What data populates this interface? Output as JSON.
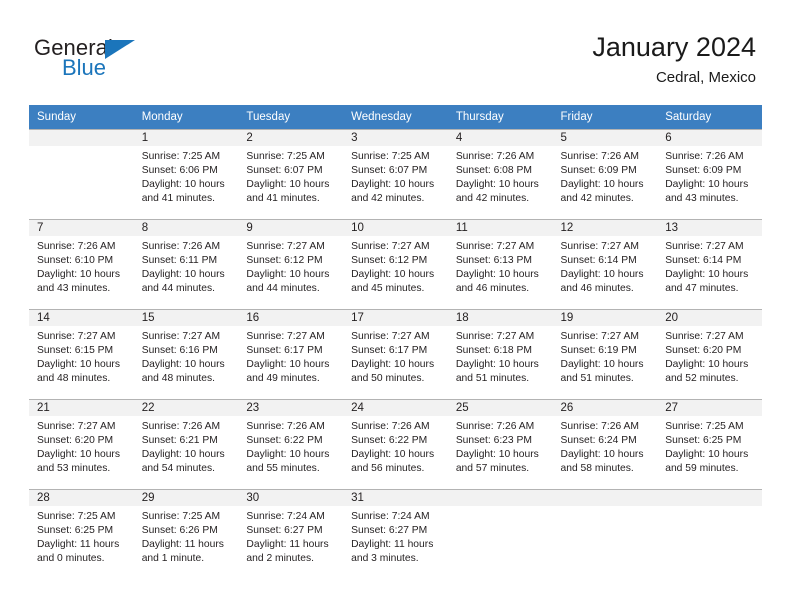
{
  "logo": {
    "word1": "General",
    "word2": "Blue",
    "triangle_color": "#1b75bb",
    "text_color": "#231f20"
  },
  "header": {
    "title": "January 2024",
    "subtitle": "Cedral, Mexico"
  },
  "theme": {
    "header_row_bg": "#3c7fc1",
    "header_row_text": "#ffffff",
    "daynum_bg": "#f2f2f2",
    "grid_line": "#b3b3b3",
    "body_text": "#231f20"
  },
  "weekdays": [
    "Sunday",
    "Monday",
    "Tuesday",
    "Wednesday",
    "Thursday",
    "Friday",
    "Saturday"
  ],
  "weeks": [
    [
      {
        "day": ""
      },
      {
        "day": "1",
        "sunrise": "Sunrise: 7:25 AM",
        "sunset": "Sunset: 6:06 PM",
        "daylight": "Daylight: 10 hours and 41 minutes."
      },
      {
        "day": "2",
        "sunrise": "Sunrise: 7:25 AM",
        "sunset": "Sunset: 6:07 PM",
        "daylight": "Daylight: 10 hours and 41 minutes."
      },
      {
        "day": "3",
        "sunrise": "Sunrise: 7:25 AM",
        "sunset": "Sunset: 6:07 PM",
        "daylight": "Daylight: 10 hours and 42 minutes."
      },
      {
        "day": "4",
        "sunrise": "Sunrise: 7:26 AM",
        "sunset": "Sunset: 6:08 PM",
        "daylight": "Daylight: 10 hours and 42 minutes."
      },
      {
        "day": "5",
        "sunrise": "Sunrise: 7:26 AM",
        "sunset": "Sunset: 6:09 PM",
        "daylight": "Daylight: 10 hours and 42 minutes."
      },
      {
        "day": "6",
        "sunrise": "Sunrise: 7:26 AM",
        "sunset": "Sunset: 6:09 PM",
        "daylight": "Daylight: 10 hours and 43 minutes."
      }
    ],
    [
      {
        "day": "7",
        "sunrise": "Sunrise: 7:26 AM",
        "sunset": "Sunset: 6:10 PM",
        "daylight": "Daylight: 10 hours and 43 minutes."
      },
      {
        "day": "8",
        "sunrise": "Sunrise: 7:26 AM",
        "sunset": "Sunset: 6:11 PM",
        "daylight": "Daylight: 10 hours and 44 minutes."
      },
      {
        "day": "9",
        "sunrise": "Sunrise: 7:27 AM",
        "sunset": "Sunset: 6:12 PM",
        "daylight": "Daylight: 10 hours and 44 minutes."
      },
      {
        "day": "10",
        "sunrise": "Sunrise: 7:27 AM",
        "sunset": "Sunset: 6:12 PM",
        "daylight": "Daylight: 10 hours and 45 minutes."
      },
      {
        "day": "11",
        "sunrise": "Sunrise: 7:27 AM",
        "sunset": "Sunset: 6:13 PM",
        "daylight": "Daylight: 10 hours and 46 minutes."
      },
      {
        "day": "12",
        "sunrise": "Sunrise: 7:27 AM",
        "sunset": "Sunset: 6:14 PM",
        "daylight": "Daylight: 10 hours and 46 minutes."
      },
      {
        "day": "13",
        "sunrise": "Sunrise: 7:27 AM",
        "sunset": "Sunset: 6:14 PM",
        "daylight": "Daylight: 10 hours and 47 minutes."
      }
    ],
    [
      {
        "day": "14",
        "sunrise": "Sunrise: 7:27 AM",
        "sunset": "Sunset: 6:15 PM",
        "daylight": "Daylight: 10 hours and 48 minutes."
      },
      {
        "day": "15",
        "sunrise": "Sunrise: 7:27 AM",
        "sunset": "Sunset: 6:16 PM",
        "daylight": "Daylight: 10 hours and 48 minutes."
      },
      {
        "day": "16",
        "sunrise": "Sunrise: 7:27 AM",
        "sunset": "Sunset: 6:17 PM",
        "daylight": "Daylight: 10 hours and 49 minutes."
      },
      {
        "day": "17",
        "sunrise": "Sunrise: 7:27 AM",
        "sunset": "Sunset: 6:17 PM",
        "daylight": "Daylight: 10 hours and 50 minutes."
      },
      {
        "day": "18",
        "sunrise": "Sunrise: 7:27 AM",
        "sunset": "Sunset: 6:18 PM",
        "daylight": "Daylight: 10 hours and 51 minutes."
      },
      {
        "day": "19",
        "sunrise": "Sunrise: 7:27 AM",
        "sunset": "Sunset: 6:19 PM",
        "daylight": "Daylight: 10 hours and 51 minutes."
      },
      {
        "day": "20",
        "sunrise": "Sunrise: 7:27 AM",
        "sunset": "Sunset: 6:20 PM",
        "daylight": "Daylight: 10 hours and 52 minutes."
      }
    ],
    [
      {
        "day": "21",
        "sunrise": "Sunrise: 7:27 AM",
        "sunset": "Sunset: 6:20 PM",
        "daylight": "Daylight: 10 hours and 53 minutes."
      },
      {
        "day": "22",
        "sunrise": "Sunrise: 7:26 AM",
        "sunset": "Sunset: 6:21 PM",
        "daylight": "Daylight: 10 hours and 54 minutes."
      },
      {
        "day": "23",
        "sunrise": "Sunrise: 7:26 AM",
        "sunset": "Sunset: 6:22 PM",
        "daylight": "Daylight: 10 hours and 55 minutes."
      },
      {
        "day": "24",
        "sunrise": "Sunrise: 7:26 AM",
        "sunset": "Sunset: 6:22 PM",
        "daylight": "Daylight: 10 hours and 56 minutes."
      },
      {
        "day": "25",
        "sunrise": "Sunrise: 7:26 AM",
        "sunset": "Sunset: 6:23 PM",
        "daylight": "Daylight: 10 hours and 57 minutes."
      },
      {
        "day": "26",
        "sunrise": "Sunrise: 7:26 AM",
        "sunset": "Sunset: 6:24 PM",
        "daylight": "Daylight: 10 hours and 58 minutes."
      },
      {
        "day": "27",
        "sunrise": "Sunrise: 7:25 AM",
        "sunset": "Sunset: 6:25 PM",
        "daylight": "Daylight: 10 hours and 59 minutes."
      }
    ],
    [
      {
        "day": "28",
        "sunrise": "Sunrise: 7:25 AM",
        "sunset": "Sunset: 6:25 PM",
        "daylight": "Daylight: 11 hours and 0 minutes."
      },
      {
        "day": "29",
        "sunrise": "Sunrise: 7:25 AM",
        "sunset": "Sunset: 6:26 PM",
        "daylight": "Daylight: 11 hours and 1 minute."
      },
      {
        "day": "30",
        "sunrise": "Sunrise: 7:24 AM",
        "sunset": "Sunset: 6:27 PM",
        "daylight": "Daylight: 11 hours and 2 minutes."
      },
      {
        "day": "31",
        "sunrise": "Sunrise: 7:24 AM",
        "sunset": "Sunset: 6:27 PM",
        "daylight": "Daylight: 11 hours and 3 minutes."
      },
      {
        "day": ""
      },
      {
        "day": ""
      },
      {
        "day": ""
      }
    ]
  ]
}
